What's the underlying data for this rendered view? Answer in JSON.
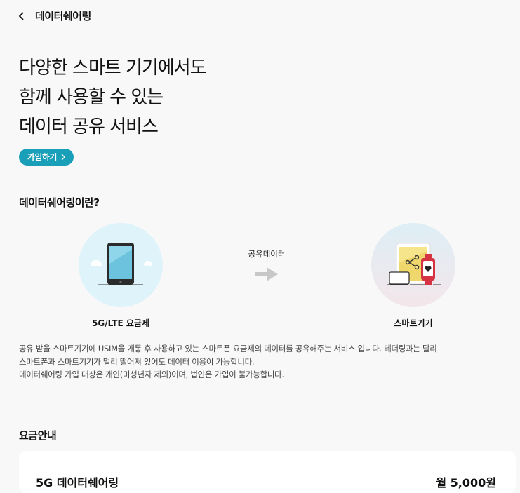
{
  "header": {
    "title": "데이터쉐어링",
    "back_icon": "chevron-left-icon"
  },
  "hero": {
    "lines": [
      "다양한 스마트 기기에서도",
      "함께 사용할 수 있는",
      "데이터 공유 서비스"
    ],
    "join_label": "가입하기",
    "join_color": "#1a9fb8"
  },
  "about": {
    "title": "데이터쉐어링이란?",
    "left_device_label": "5G/LTE 요금제",
    "right_device_label": "스마트기기",
    "share_label": "공유데이터",
    "icons": [
      "smartphone-icon",
      "arrow-right-icon",
      "smart-devices-icon"
    ]
  },
  "description": {
    "lines": [
      "공유 받을 스마트기기에 USIM을 개통 후 사용하고 있는 스마트폰 요금제의 데이터를 공유해주는 서비스 입니다. 테더링과는 달리",
      "스마트폰과 스마트기기가 멀리 떨어져 있어도 데이터 이용이 가능합니다.",
      "데이터쉐어링 가입 대상은 개인(미성년자 제외)이며, 법인은 가입이 불가능합니다."
    ]
  },
  "pricing": {
    "title": "요금안내",
    "plan_name": "5G 데이터쉐어링",
    "plan_price": "월 5,000원"
  }
}
